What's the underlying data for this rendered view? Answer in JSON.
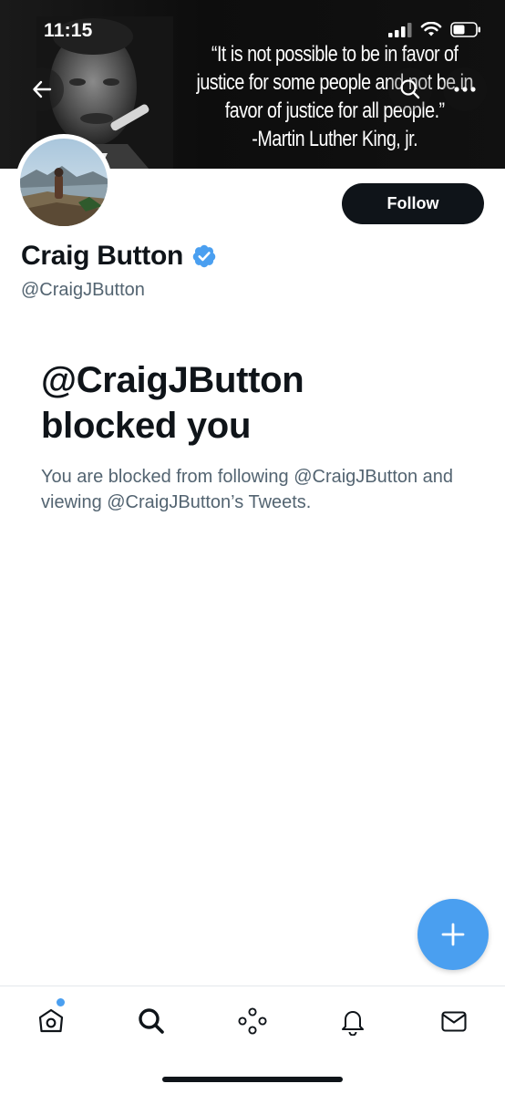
{
  "status_bar": {
    "time": "11:15"
  },
  "banner": {
    "quote_lines": [
      "“It is not possible to be in favor of",
      "justice for some people and not be in",
      "favor of justice for all people.”",
      "-Martin Luther King, jr."
    ]
  },
  "profile": {
    "display_name": "Craig Button",
    "handle": "@CraigJButton",
    "verified": true,
    "follow_label": "Follow"
  },
  "blocked": {
    "title_line1": "@CraigJButton",
    "title_line2": "blocked you",
    "description": "You are blocked from following @CraigJButton and viewing @CraigJButton’s Tweets."
  },
  "bottom_nav": {
    "items": [
      "home-icon",
      "search-icon",
      "spaces-icon",
      "notifications-icon",
      "messages-icon"
    ],
    "home_has_unread_dot": true
  },
  "colors": {
    "accent": "#4a9ff0",
    "text_primary": "#0f1419",
    "text_secondary": "#536471"
  }
}
